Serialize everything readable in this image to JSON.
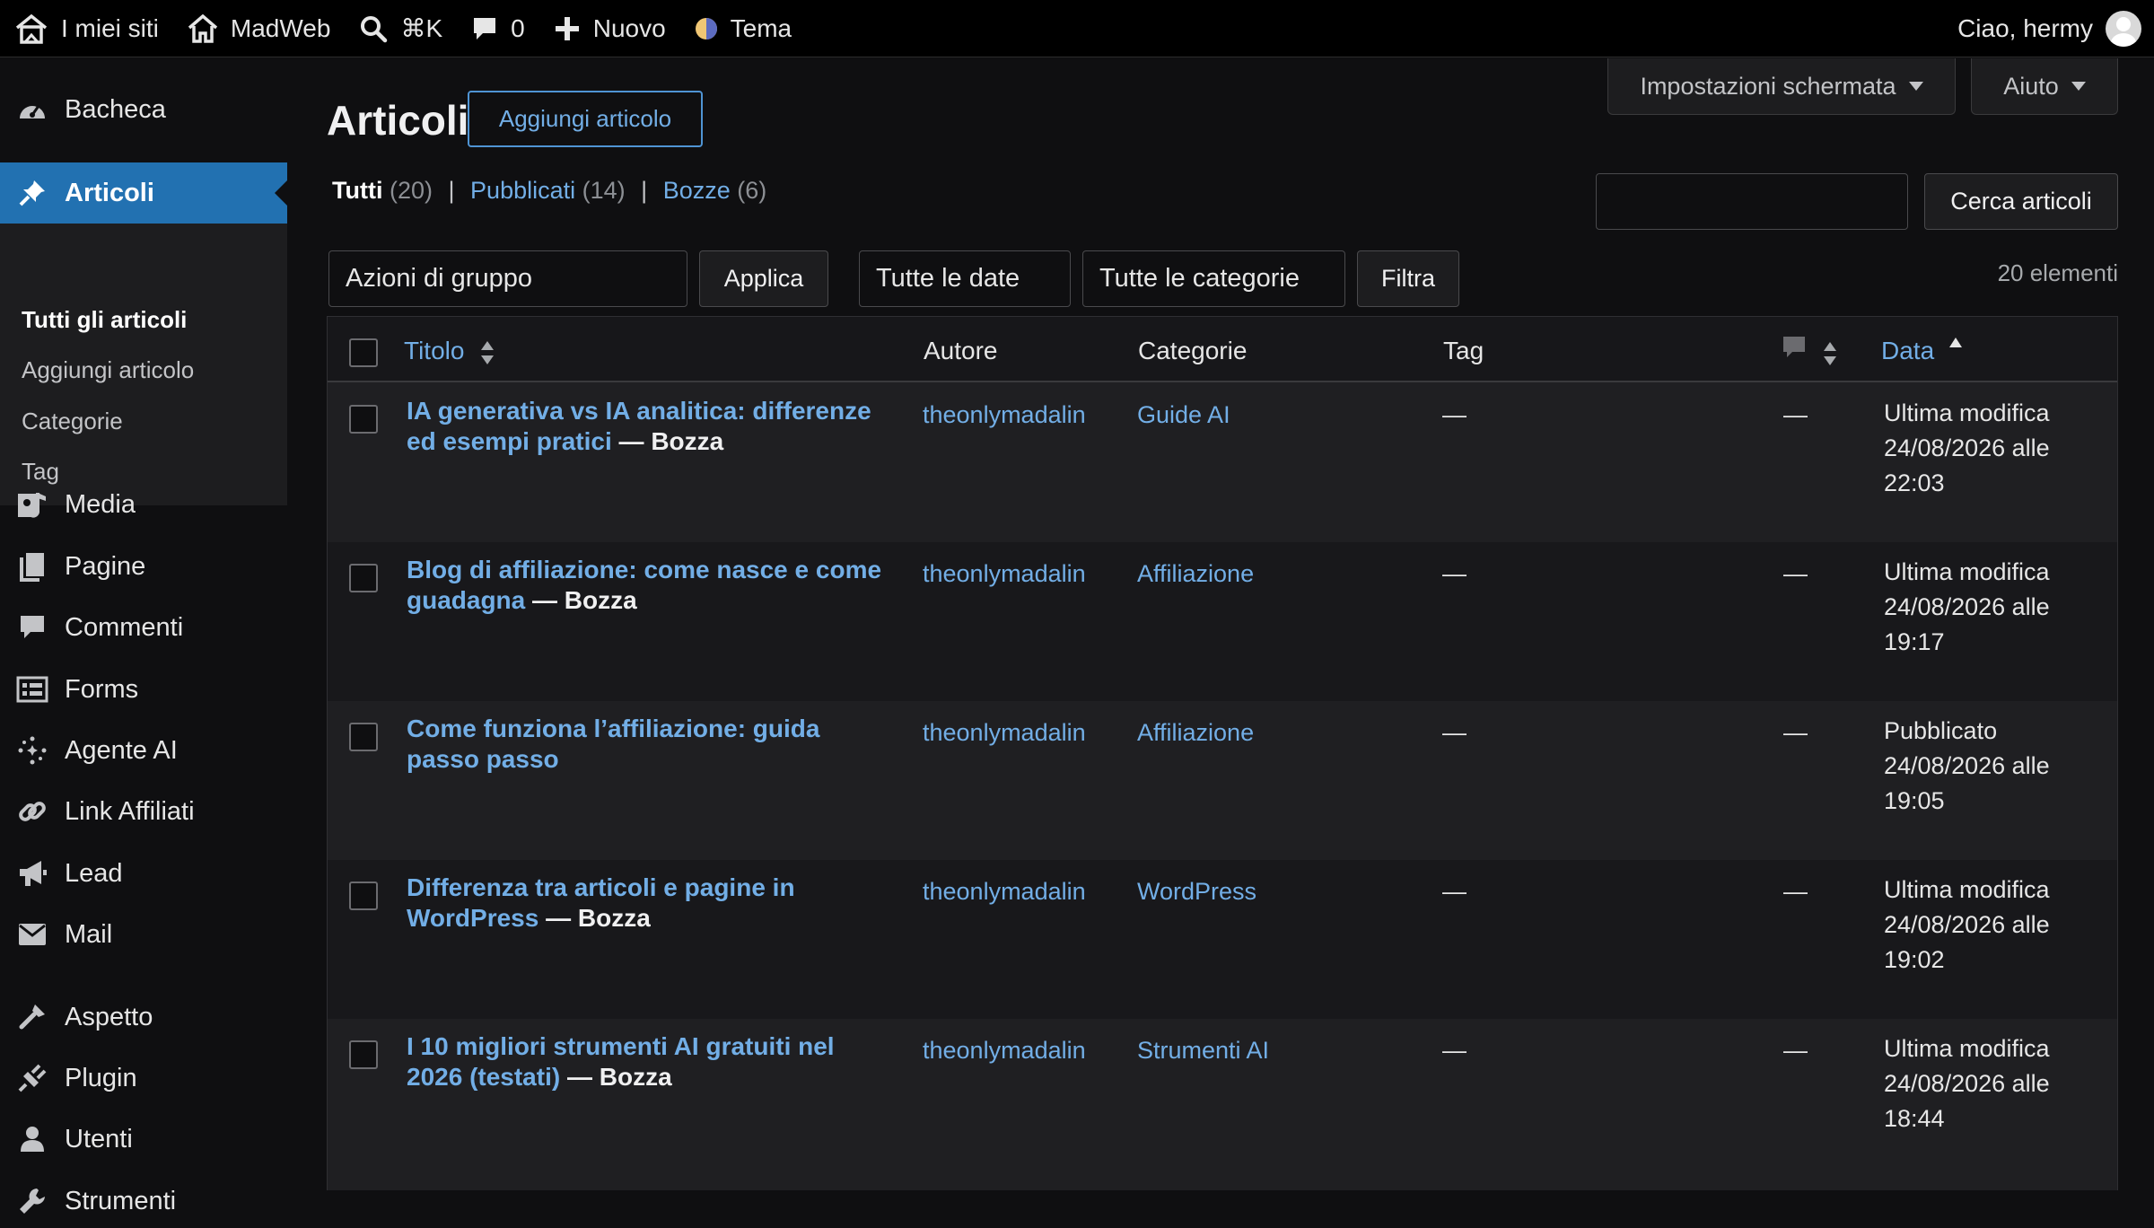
{
  "adminbar": {
    "my_sites": "I miei siti",
    "site_name": "MadWeb",
    "search_shortcut": "⌘K",
    "comments_count": "0",
    "new_label": "Nuovo",
    "theme_label": "Tema",
    "greeting": "Ciao, hermy"
  },
  "sidebar": {
    "items": [
      {
        "label": "Bacheca",
        "icon": "dashboard-icon"
      },
      {
        "label": "Articoli",
        "icon": "pin-icon"
      },
      {
        "label": "Media",
        "icon": "media-icon"
      },
      {
        "label": "Pagine",
        "icon": "pages-icon"
      },
      {
        "label": "Commenti",
        "icon": "comment-icon"
      },
      {
        "label": "Forms",
        "icon": "forms-icon"
      },
      {
        "label": "Agente AI",
        "icon": "sparkle-icon"
      },
      {
        "label": "Link Affiliati",
        "icon": "link-icon"
      },
      {
        "label": "Lead",
        "icon": "megaphone-icon"
      },
      {
        "label": "Mail",
        "icon": "mail-icon"
      },
      {
        "label": "Aspetto",
        "icon": "brush-icon"
      },
      {
        "label": "Plugin",
        "icon": "plug-icon"
      },
      {
        "label": "Utenti",
        "icon": "user-icon"
      },
      {
        "label": "Strumenti",
        "icon": "wrench-icon"
      }
    ],
    "submenu": [
      "Tutti gli articoli",
      "Aggiungi articolo",
      "Categorie",
      "Tag"
    ]
  },
  "header": {
    "title": "Articoli",
    "add_button": "Aggiungi articolo",
    "screen_options": "Impostazioni schermata",
    "help": "Aiuto"
  },
  "views": {
    "all_label": "Tutti",
    "all_count": "(20)",
    "published_label": "Pubblicati",
    "published_count": "(14)",
    "drafts_label": "Bozze",
    "drafts_count": "(6)"
  },
  "search": {
    "value": "",
    "button": "Cerca articoli"
  },
  "filters": {
    "bulk_actions": "Azioni di gruppo",
    "apply": "Applica",
    "dates": "Tutte le date",
    "categories": "Tutte le categorie",
    "filter": "Filtra",
    "items_count": "20 elementi"
  },
  "table": {
    "columns": {
      "title": "Titolo",
      "author": "Autore",
      "categories": "Categorie",
      "tags": "Tag",
      "date": "Data"
    },
    "rows": [
      {
        "title": "IA generativa vs IA analitica: differenze ed esempi pratici",
        "state": "— Bozza",
        "author": "theonlymadalin",
        "category": "Guide AI",
        "tags": "—",
        "comments": "—",
        "date_status": "Ultima modifica",
        "date_value": "24/08/2026 alle",
        "date_time": "22:03"
      },
      {
        "title": "Blog di affiliazione: come nasce e come guadagna",
        "state": "— Bozza",
        "author": "theonlymadalin",
        "category": "Affiliazione",
        "tags": "—",
        "comments": "—",
        "date_status": "Ultima modifica",
        "date_value": "24/08/2026 alle",
        "date_time": "19:17"
      },
      {
        "title": "Come funziona l’affiliazione: guida passo passo",
        "state": "",
        "author": "theonlymadalin",
        "category": "Affiliazione",
        "tags": "—",
        "comments": "—",
        "date_status": "Pubblicato",
        "date_value": "24/08/2026 alle",
        "date_time": "19:05"
      },
      {
        "title": "Differenza tra articoli e pagine in WordPress",
        "state": "— Bozza",
        "author": "theonlymadalin",
        "category": "WordPress",
        "tags": "—",
        "comments": "—",
        "date_status": "Ultima modifica",
        "date_value": "24/08/2026 alle",
        "date_time": "19:02"
      },
      {
        "title": "I 10 migliori strumenti AI gratuiti nel 2026 (testati)",
        "state": "— Bozza",
        "author": "theonlymadalin",
        "category": "Strumenti AI",
        "tags": "—",
        "comments": "—",
        "date_status": "Ultima modifica",
        "date_value": "24/08/2026 alle",
        "date_time": "18:44"
      }
    ]
  },
  "colors": {
    "accent": "#2271b1",
    "link": "#72aee6",
    "background": "#0f0f11",
    "table_bg": "#1f1f22"
  }
}
